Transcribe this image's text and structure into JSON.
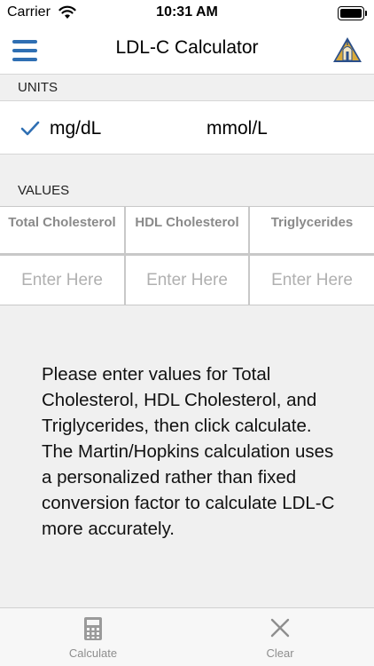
{
  "status_bar": {
    "carrier": "Carrier",
    "time": "10:31 AM",
    "wifi_icon": "wifi-icon",
    "battery_icon": "battery-icon"
  },
  "nav": {
    "title": "LDL-C Calculator",
    "menu_icon": "hamburger-menu-icon",
    "logo_icon": "hopkins-logo-icon"
  },
  "units": {
    "header": "UNITS",
    "options": [
      "mg/dL",
      "mmol/L"
    ],
    "selected": "mg/dL"
  },
  "values": {
    "header": "VALUES",
    "columns": [
      {
        "label": "Total Cholesterol",
        "placeholder": "Enter Here"
      },
      {
        "label": "HDL Cholesterol",
        "placeholder": "Enter Here"
      },
      {
        "label": "Triglycerides",
        "placeholder": "Enter Here"
      }
    ]
  },
  "info": {
    "text": "Please enter values for Total Cholesterol, HDL Cholesterol, and Triglycerides, then click calculate. The Martin/Hopkins calculation uses a personalized rather than fixed conversion factor to calculate LDL-C more accurately."
  },
  "tab_bar": {
    "calculate_label": "Calculate",
    "clear_label": "Clear"
  },
  "colors": {
    "accent": "#2f6fb3",
    "tab_inactive": "#8e8e8e",
    "placeholder": "#b0b0b0",
    "background": "#f0f0f0"
  }
}
